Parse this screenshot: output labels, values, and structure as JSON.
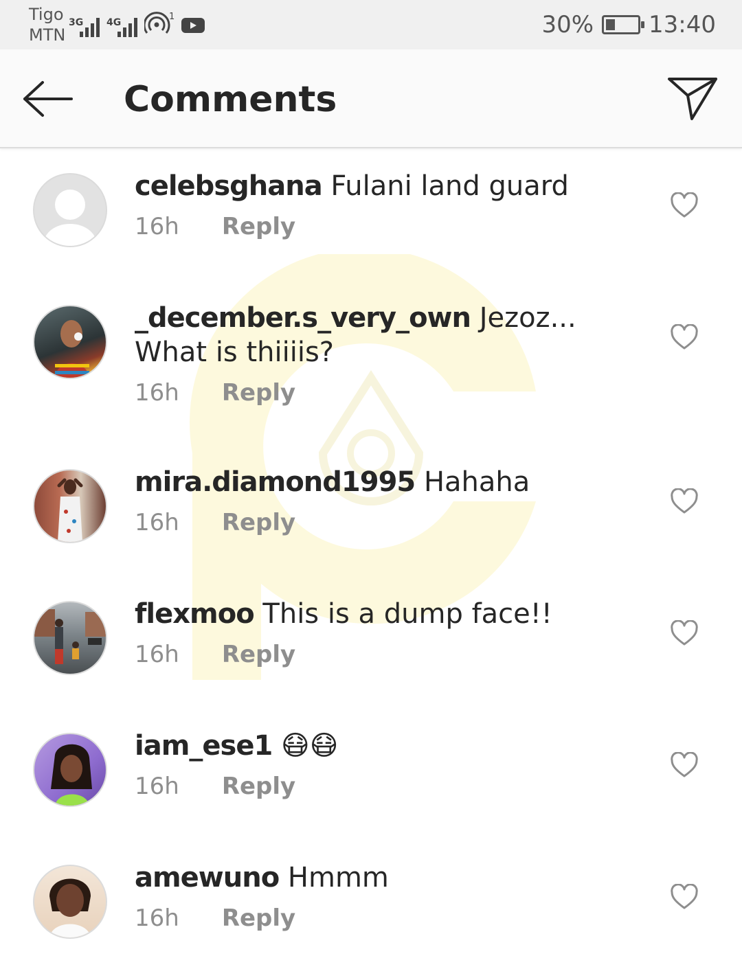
{
  "status_bar": {
    "carrier_1": "Tigo",
    "carrier_2": "MTN",
    "network_1": "3G",
    "network_2": "4G",
    "hotspot_count": "1",
    "battery_percent": "30%",
    "battery_level": 0.3,
    "time": "13:40"
  },
  "header": {
    "title": "Comments",
    "back_icon": "arrow-left-icon",
    "share_icon": "paper-plane-icon"
  },
  "comments": [
    {
      "username": "celebsghana",
      "text": "Fulani land guard",
      "time": "16h",
      "reply_label": "Reply",
      "avatar": "default-avatar"
    },
    {
      "username": "_december.s_very_own",
      "text": "Jezoz... What is thiiiis?",
      "time": "16h",
      "reply_label": "Reply",
      "avatar": "photo-avatar"
    },
    {
      "username": "mira.diamond1995",
      "text": "Hahaha",
      "time": "16h",
      "reply_label": "Reply",
      "avatar": "photo-avatar"
    },
    {
      "username": "flexmoo",
      "text": "This is a dump face!!",
      "time": "16h",
      "reply_label": "Reply",
      "avatar": "photo-avatar"
    },
    {
      "username": "iam_ese1",
      "text": "😷😷",
      "time": "16h",
      "reply_label": "Reply",
      "avatar": "photo-avatar"
    },
    {
      "username": "amewuno",
      "text": "Hmmm",
      "time": "16h",
      "reply_label": "Reply",
      "avatar": "photo-avatar"
    }
  ],
  "colors": {
    "text": "#262626",
    "meta": "#8e8e8e",
    "header_bg": "#fafafa",
    "status_bg": "#f0f0f0",
    "watermark": "#f5d800"
  }
}
